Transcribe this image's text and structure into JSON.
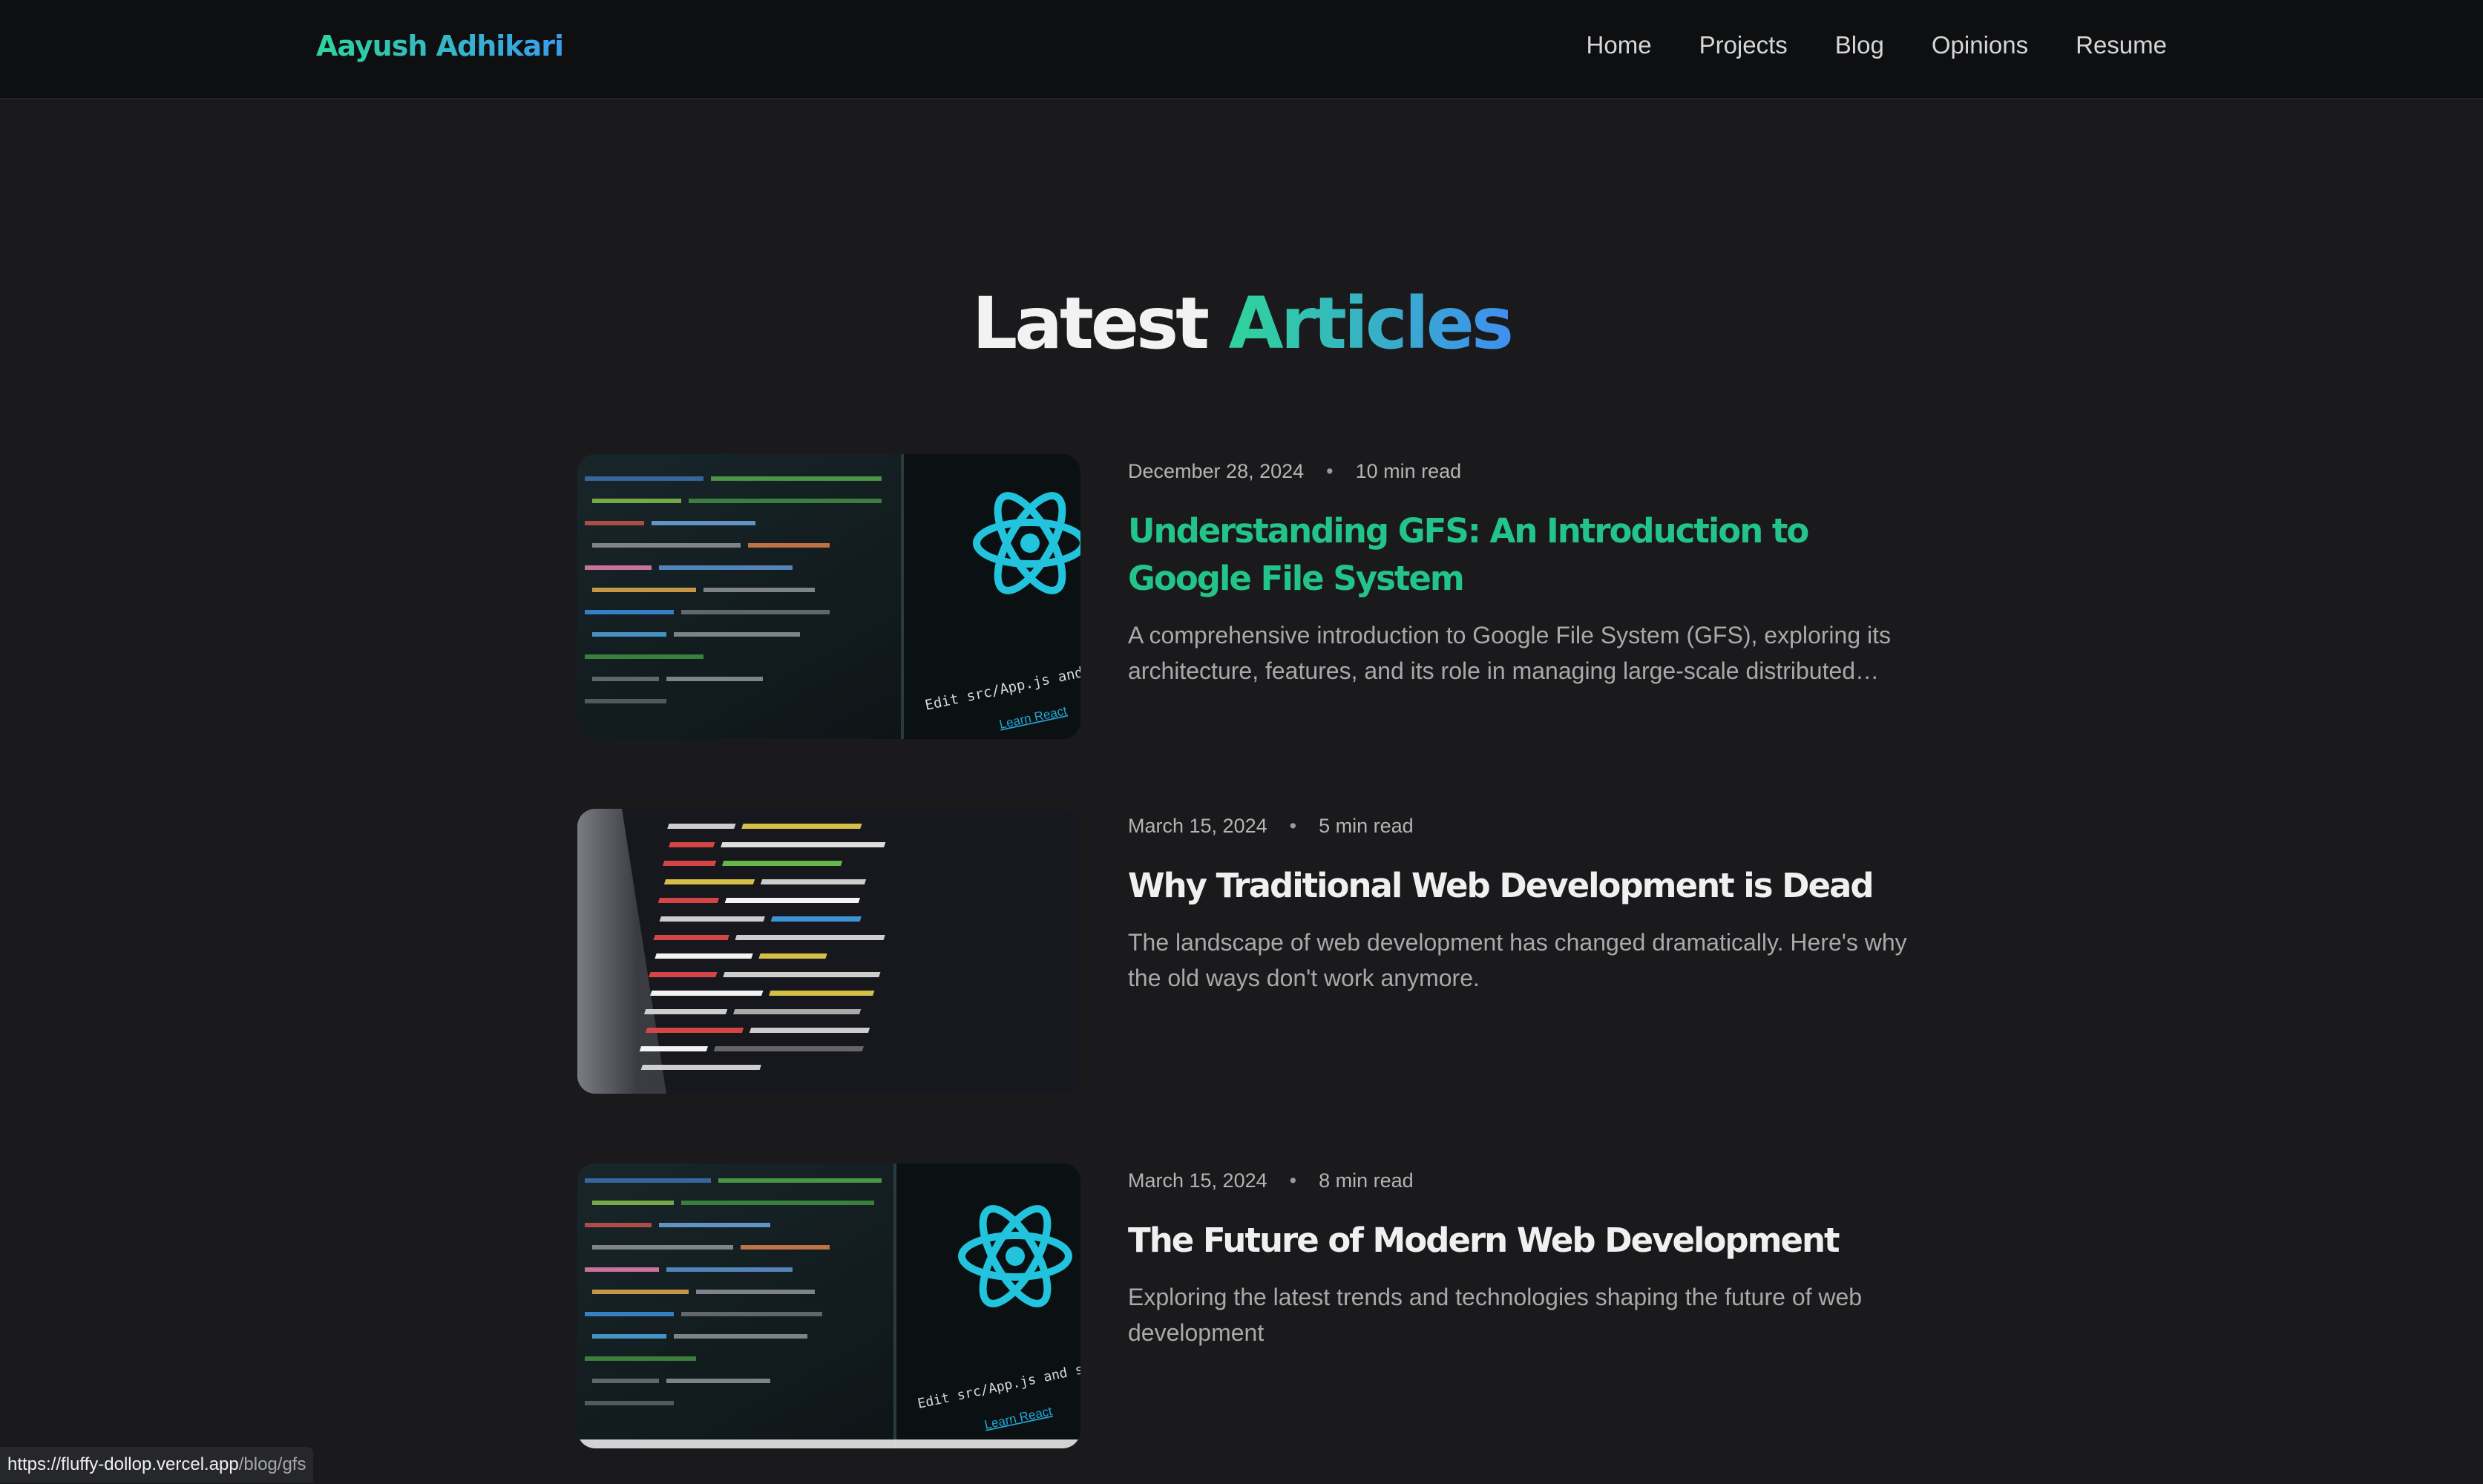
{
  "header": {
    "brand": "Aayush Adhikari",
    "nav": [
      {
        "label": "Home"
      },
      {
        "label": "Projects"
      },
      {
        "label": "Blog"
      },
      {
        "label": "Opinions"
      },
      {
        "label": "Resume"
      }
    ]
  },
  "section": {
    "title_part1": "Latest",
    "title_part2": "Articles"
  },
  "articles": [
    {
      "date": "December 28, 2024",
      "read_time": "10 min read",
      "title": "Understanding GFS: An Introduction to Google File System",
      "excerpt": "A comprehensive introduction to Google File System (GFS), exploring its architecture, features, and its role in managing large-scale distributed systems.",
      "thumb_icon": "react-code-editor-image",
      "thumb_text": "Edit src/App.js and save",
      "thumb_link": "Learn React"
    },
    {
      "date": "March 15, 2024",
      "read_time": "5 min read",
      "title": "Why Traditional Web Development is Dead",
      "excerpt": "The landscape of web development has changed dramatically. Here's why the old ways don't work anymore.",
      "thumb_icon": "code-screen-image"
    },
    {
      "date": "March 15, 2024",
      "read_time": "8 min read",
      "title": "The Future of Modern Web Development",
      "excerpt": "Exploring the latest trends and technologies shaping the future of web development",
      "thumb_icon": "react-code-editor-image",
      "thumb_text": "Edit src/App.js and save to rel",
      "thumb_link": "Learn React"
    }
  ],
  "status_bar": {
    "host": "https://fluffy-dollop.vercel.app",
    "path": "/blog/gfs"
  },
  "colors": {
    "accent_green": "#23c48a",
    "accent_blue": "#3f8ff0",
    "background": "#1a1a1c",
    "header_bg": "#0e0f11"
  }
}
